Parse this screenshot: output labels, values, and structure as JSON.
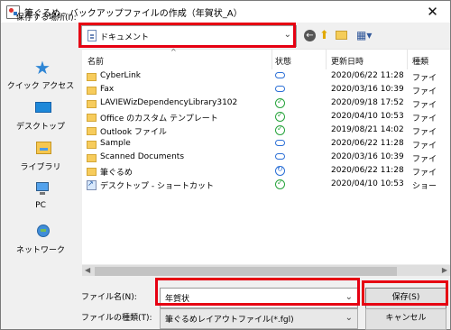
{
  "window": {
    "title": "筆ぐるめ - バックアップファイルの作成（年賀状_A）",
    "close_label": "✕"
  },
  "toolbar": {
    "save_location_label": "保存する場所(I):",
    "location_value": "ドキュメント"
  },
  "icons": {
    "back": "back-icon",
    "up": "up-icon",
    "new_folder": "new-folder-icon",
    "views": "views-icon"
  },
  "sidebar": {
    "items": [
      {
        "label": "クイック アクセス"
      },
      {
        "label": "デスクトップ"
      },
      {
        "label": "ライブラリ"
      },
      {
        "label": "PC"
      },
      {
        "label": "ネットワーク"
      }
    ]
  },
  "table": {
    "headers": [
      "名前",
      "状態",
      "更新日時",
      "種類"
    ],
    "rows": [
      {
        "name": "CyberLink",
        "status": "cloud",
        "date": "2020/06/22 11:28",
        "type": "ファイ"
      },
      {
        "name": "Fax",
        "status": "cloud",
        "date": "2020/03/16 10:39",
        "type": "ファイ"
      },
      {
        "name": "LAVIEWizDependencyLibrary3102",
        "status": "check",
        "date": "2020/09/18 17:52",
        "type": "ファイ"
      },
      {
        "name": "Office のカスタム テンプレート",
        "status": "check",
        "date": "2020/04/10 10:53",
        "type": "ファイ"
      },
      {
        "name": "Outlook ファイル",
        "status": "check",
        "date": "2019/08/21 14:02",
        "type": "ファイ"
      },
      {
        "name": "Sample",
        "status": "cloud",
        "date": "2020/06/22 11:28",
        "type": "ファイ"
      },
      {
        "name": "Scanned Documents",
        "status": "cloud",
        "date": "2020/03/16 10:39",
        "type": "ファイ"
      },
      {
        "name": "筆ぐるめ",
        "status": "sync",
        "date": "2020/06/22 11:28",
        "type": "ファイ"
      },
      {
        "name": "デスクトップ - ショートカット",
        "status": "check",
        "date": "2020/04/10 10:53",
        "type": "ショー"
      }
    ]
  },
  "form": {
    "file_name_label": "ファイル名(N):",
    "file_name_value": "年賀状",
    "file_type_label": "ファイルの種類(T):",
    "file_type_value": "筆ぐるめレイアウトファイル(*.fgl)",
    "save_button": "保存(S)",
    "cancel_button": "キャンセル"
  },
  "accent_colors": {
    "highlight": "#e60012"
  }
}
